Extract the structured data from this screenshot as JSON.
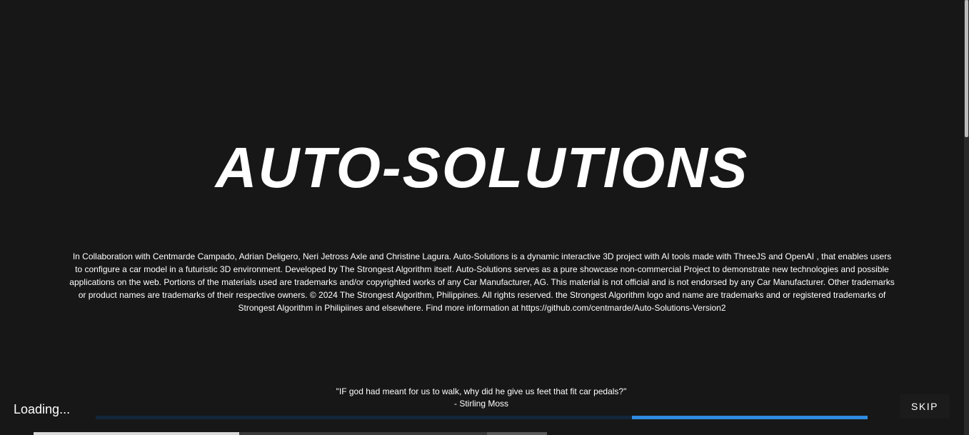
{
  "intro": {
    "title": "AUTO-SOLUTIONS",
    "disclaimer": "In Collaboration with Centmarde Campado, Adrian Deligero, Neri Jetross Axle and Christine Lagura. Auto-Solutions is a dynamic interactive 3D project with AI tools made with ThreeJS and OpenAI , that enables users to configure a car model in a futuristic 3D environment. Developed by The Strongest Algorithm itself. Auto-Solutions serves as a pure showcase non-commercial Project to demonstrate new technologies and possible applications on the web. Portions of the materials used are trademarks and/or copyrighted works of any Car Manufacturer, AG. This material is not official and is not endorsed by any Car Manufacturer. Other trademarks or product names are trademarks of their respective owners. © 2024 The Strongest Algorithm, Philippines. All rights reserved. the Strongest Algorithm logo and name are trademarks and or registered trademarks of Strongest Algorithm in Philipiines and elsewhere. Find more information at https://github.com/centmarde/Auto-Solutions-Version2"
  },
  "quote": {
    "text": "\"IF god had meant for us to walk, why did he give us feet that fit car pedals?\"",
    "author": "- Stirling Moss"
  },
  "loader": {
    "label": "Loading...",
    "progress_fraction": 0.305,
    "track_color": "#13263a",
    "fill_color": "#2f8be0"
  },
  "controls": {
    "skip_label": "SKIP"
  },
  "colors": {
    "background": "#171717",
    "text": "#ffffff",
    "accent": "#2f8be0"
  }
}
